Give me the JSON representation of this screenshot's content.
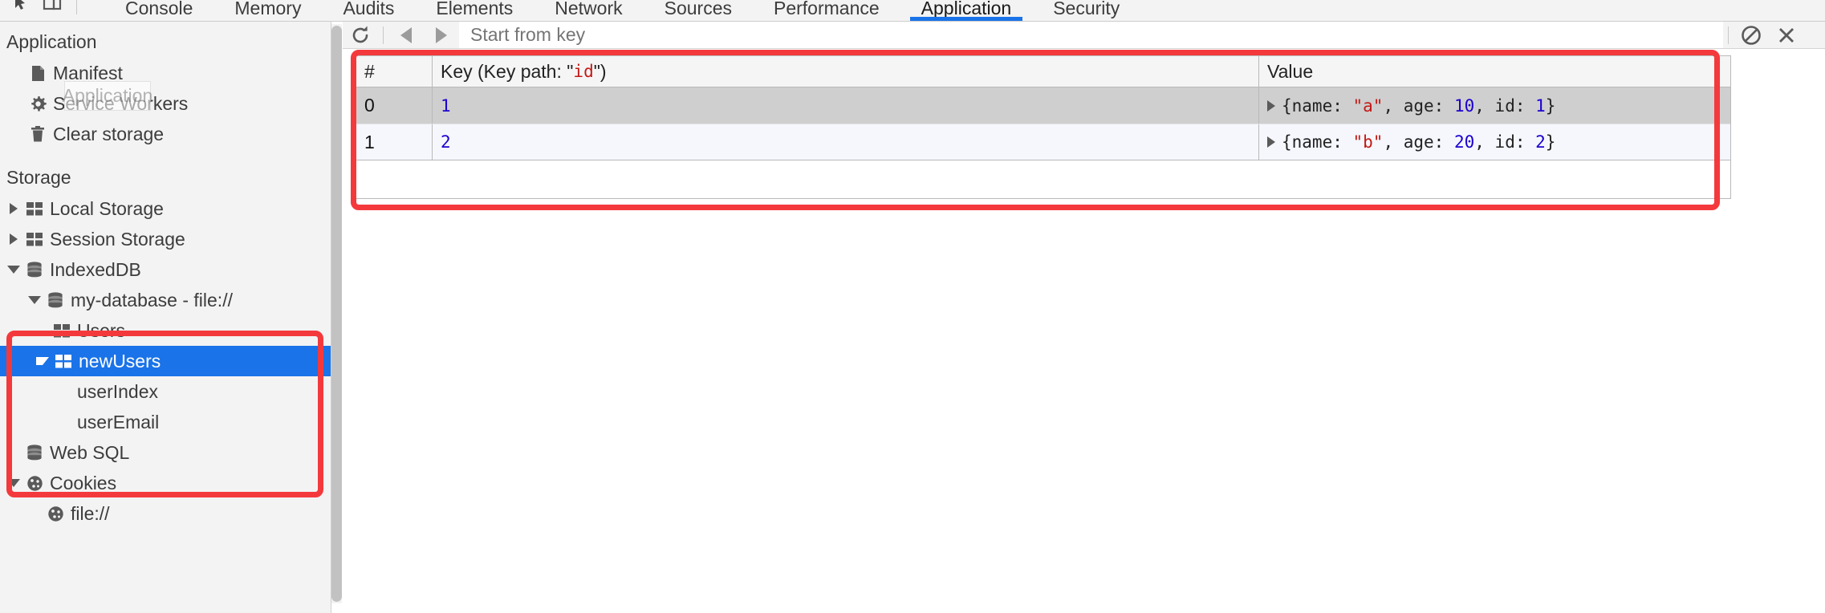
{
  "devtools": {
    "icons": [
      {
        "name": "inspect-element-icon",
        "label": "Inspect element"
      },
      {
        "name": "device-toolbar-icon",
        "label": "Toggle device toolbar"
      }
    ],
    "tabs": [
      {
        "label": "Console",
        "active": false
      },
      {
        "label": "Memory",
        "active": false
      },
      {
        "label": "Audits",
        "active": false
      },
      {
        "label": "Elements",
        "active": false
      },
      {
        "label": "Network",
        "active": false
      },
      {
        "label": "Sources",
        "active": false
      },
      {
        "label": "Performance",
        "active": false
      },
      {
        "label": "Application",
        "active": true
      },
      {
        "label": "Security",
        "active": false
      }
    ]
  },
  "sidebar": {
    "application_heading": "Application",
    "application_items": [
      {
        "label": "Manifest",
        "icon": "document-icon"
      },
      {
        "label": "Service Workers",
        "icon": "gear-icon"
      },
      {
        "label": "Clear storage",
        "icon": "trash-icon"
      }
    ],
    "storage_heading": "Storage",
    "tooltip": "Application",
    "storage_items": [
      {
        "label": "Local Storage",
        "icon": "table-icon",
        "twisty": "collapsed",
        "indent": 1,
        "selected": false
      },
      {
        "label": "Session Storage",
        "icon": "table-icon",
        "twisty": "collapsed",
        "indent": 1,
        "selected": false
      },
      {
        "label": "IndexedDB",
        "icon": "database-icon",
        "twisty": "expanded",
        "indent": 1,
        "selected": false
      },
      {
        "label": "my-database - file://",
        "icon": "database-icon",
        "twisty": "expanded",
        "indent": 2,
        "selected": false
      },
      {
        "label": "Users",
        "icon": "table-icon",
        "twisty": "none",
        "indent": 3,
        "selected": false
      },
      {
        "label": "newUsers",
        "icon": "table-icon",
        "twisty": "expanded",
        "indent": 3,
        "selected": true
      },
      {
        "label": "userIndex",
        "icon": "none",
        "twisty": "none",
        "indent": 4,
        "selected": false
      },
      {
        "label": "userEmail",
        "icon": "none",
        "twisty": "none",
        "indent": 4,
        "selected": false
      },
      {
        "label": "Web SQL",
        "icon": "database-icon",
        "twisty": "none",
        "indent": 1,
        "selected": false
      },
      {
        "label": "Cookies",
        "icon": "cookie-icon",
        "twisty": "expanded",
        "indent": 1,
        "selected": false
      },
      {
        "label": "file://",
        "icon": "cookie-icon",
        "twisty": "none",
        "indent": 2,
        "selected": false
      }
    ]
  },
  "toolbar": {
    "refresh_label": "Refresh",
    "prev_label": "Show previous page",
    "next_label": "Show next page",
    "key_filter_placeholder": "Start from key",
    "key_filter_value": "",
    "clear_all_label": "Clear object store",
    "delete_label": "Delete selected"
  },
  "grid": {
    "columns": [
      {
        "key": "index",
        "label": "#"
      },
      {
        "key": "key",
        "label_prefix": "Key (Key path: \"",
        "label_code": "id",
        "label_suffix": "\")"
      },
      {
        "key": "value",
        "label": "Value"
      }
    ],
    "rows": [
      {
        "index": "0",
        "key": "1",
        "selected": true,
        "value_tokens": [
          {
            "t": "{name: ",
            "k": "plain"
          },
          {
            "t": "\"a\"",
            "k": "str"
          },
          {
            "t": ", age: ",
            "k": "plain"
          },
          {
            "t": "10",
            "k": "num"
          },
          {
            "t": ", id: ",
            "k": "plain"
          },
          {
            "t": "1",
            "k": "num"
          },
          {
            "t": "}",
            "k": "plain"
          }
        ]
      },
      {
        "index": "1",
        "key": "2",
        "selected": false,
        "value_tokens": [
          {
            "t": "{name: ",
            "k": "plain"
          },
          {
            "t": "\"b\"",
            "k": "str"
          },
          {
            "t": ", age: ",
            "k": "plain"
          },
          {
            "t": "20",
            "k": "num"
          },
          {
            "t": ", id: ",
            "k": "plain"
          },
          {
            "t": "2",
            "k": "num"
          },
          {
            "t": "}",
            "k": "plain"
          }
        ]
      }
    ]
  },
  "annotations": {
    "accent_color": "#f4393c",
    "boxes": [
      {
        "name": "grid-highlight",
        "target": "object-store-data-grid"
      },
      {
        "name": "tree-highlight",
        "target": "indexeddb-database-subtree"
      }
    ]
  },
  "colors": {
    "accent_blue": "#1a73e8",
    "selection_blue": "#1a73e8",
    "panel_bg": "#f3f3f3",
    "string_token": "#c41a16",
    "number_token": "#1c00cf",
    "annotation_red": "#f4393c"
  }
}
